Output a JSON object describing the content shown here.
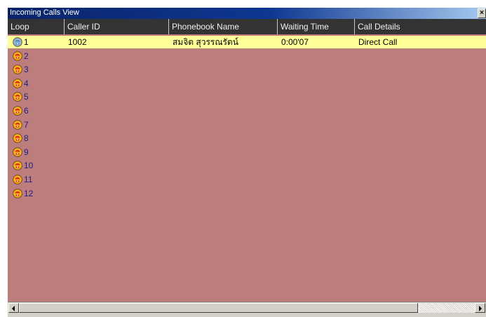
{
  "window": {
    "title": "Incoming Calls View",
    "close_glyph": "×"
  },
  "columns": [
    "Loop",
    "Caller ID",
    "Phonebook Name",
    "Waiting Time",
    "Call Details"
  ],
  "rows": [
    {
      "loop": "1",
      "caller_id": "1002",
      "phonebook_name": "สมจิต สุวรรณรัตน์",
      "waiting_time": "0:00'07",
      "call_details": "Direct Call",
      "icon": "phone-active-icon"
    },
    {
      "loop": "2",
      "icon": "phone-idle-icon"
    },
    {
      "loop": "3",
      "icon": "phone-idle-icon"
    },
    {
      "loop": "4",
      "icon": "phone-idle-icon"
    },
    {
      "loop": "5",
      "icon": "phone-idle-icon"
    },
    {
      "loop": "6",
      "icon": "phone-idle-icon"
    },
    {
      "loop": "7",
      "icon": "phone-idle-icon"
    },
    {
      "loop": "8",
      "icon": "phone-idle-icon"
    },
    {
      "loop": "9",
      "icon": "phone-idle-icon"
    },
    {
      "loop": "10",
      "icon": "phone-idle-icon"
    },
    {
      "loop": "11",
      "icon": "phone-idle-icon"
    },
    {
      "loop": "12",
      "icon": "phone-idle-icon"
    }
  ],
  "colors": {
    "list_background": "#bb7e7d",
    "selected_row": "#ffff99",
    "header_background": "#333333",
    "loop_text": "#1e1e8c"
  },
  "scrollbar": {
    "left_arrow": "scroll-left-icon",
    "right_arrow": "scroll-right-icon"
  }
}
